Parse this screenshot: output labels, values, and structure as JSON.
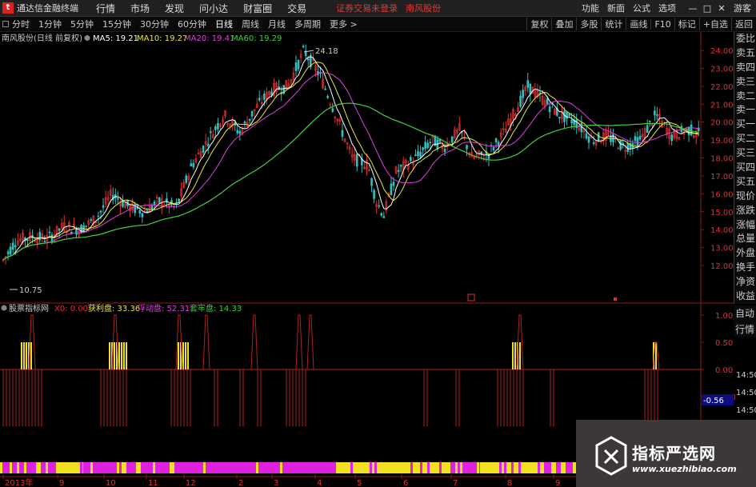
{
  "menubar": {
    "app_name": "通达信金融终端",
    "items": [
      "行情",
      "市场",
      "发现",
      "问小达",
      "财富圈",
      "交易"
    ],
    "notice": "证券交易未登录",
    "stock_name": "南风股份",
    "right_items": [
      "功能",
      "新面",
      "公式",
      "选项"
    ],
    "guest": "游客",
    "window_controls": [
      "—",
      "□",
      "✕"
    ]
  },
  "toolbar": {
    "periods": [
      "分时",
      "1分钟",
      "5分钟",
      "15分钟",
      "30分钟",
      "60分钟",
      "日线",
      "周线",
      "月线",
      "多周期",
      "更多 >"
    ],
    "active_period": "日线",
    "right_buttons": [
      "复权",
      "叠加",
      "多股",
      "统计",
      "画线",
      "F10",
      "标记",
      "+自选",
      "返回"
    ]
  },
  "main_legend": {
    "title": "南风股份(日线 前复权)",
    "ma": [
      {
        "label": "MA5: 19.21",
        "color": "#ffffff"
      },
      {
        "label": "MA10: 19.27",
        "color": "#e8e83c"
      },
      {
        "label": "MA20: 19.41",
        "color": "#e040e0"
      },
      {
        "label": "MA60: 19.29",
        "color": "#40d040"
      }
    ]
  },
  "price_axis": [
    "24.00",
    "23.00",
    "22.00",
    "21.00",
    "20.00",
    "19.00",
    "18.00",
    "17.00",
    "16.00",
    "15.00",
    "14.00",
    "13.00",
    "12.00"
  ],
  "price_annotations": {
    "high": "24.18",
    "low": "10.75"
  },
  "indicator_legend": {
    "title": "股票指标网",
    "items": [
      {
        "label": "X0: 0.00",
        "color": "#e03030"
      },
      {
        "label": "获利盘: 33.36",
        "color": "#e8e83c"
      },
      {
        "label": "浮动盘: 52.31",
        "color": "#e040e0"
      },
      {
        "label": "套牢盘: 14.33",
        "color": "#40d040"
      }
    ]
  },
  "indicator_axis": [
    "1.00",
    "0.50",
    "0.00",
    "-0.50",
    "-1.00"
  ],
  "indicator_current": "-0.56",
  "time_axis": [
    "2013年",
    "9",
    "10",
    "11",
    "12",
    "2",
    "3",
    "4",
    "5",
    "6",
    "7",
    "8",
    "9"
  ],
  "side_panel": [
    "委比",
    "卖五",
    "卖四",
    "卖三",
    "卖二",
    "卖一",
    "买一",
    "买二",
    "买三",
    "买四",
    "买五",
    "现价",
    "涨跌",
    "涨幅",
    "总量",
    "外盘",
    "换手",
    "净资",
    "收益"
  ],
  "side_panel_lower": [
    "自动",
    "行情"
  ],
  "side_times": [
    "14:50",
    "14:50",
    "14:50",
    "14:50",
    "14:50"
  ],
  "watermark": {
    "title": "指标严选网",
    "url": "www.xuezhibiao.com"
  },
  "colors": {
    "up": "#e03030",
    "down": "#30c0c0",
    "ma5": "#ffffff",
    "ma10": "#e8e83c",
    "ma20": "#e040e0",
    "ma60": "#40d040",
    "bar_yellow": "#f0e020",
    "bar_magenta": "#e020e0",
    "axis_red": "#8b1a1a"
  }
}
